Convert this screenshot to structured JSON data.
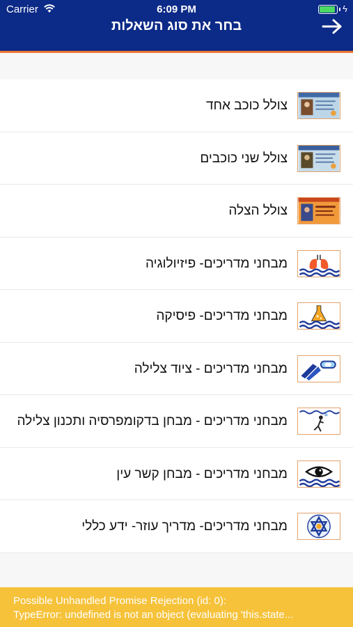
{
  "status_bar": {
    "carrier": "Carrier",
    "time": "6:09 PM",
    "battery_level": 0.9,
    "battery_color": "#4cd964"
  },
  "header": {
    "title": "בחר את סוג השאלות",
    "back_icon": "arrow-right-icon",
    "background": "#0c2a87",
    "accent": "#f0762f"
  },
  "items": [
    {
      "label": "צולל כוכב אחד",
      "icon": "one-star-card-icon"
    },
    {
      "label": "צולל שני כוכבים",
      "icon": "two-star-card-icon"
    },
    {
      "label": "צולל הצלה",
      "icon": "rescue-card-icon"
    },
    {
      "label": "מבחני מדריכים- פיזיולוגיה",
      "icon": "lungs-waves-icon"
    },
    {
      "label": "מבחני מדריכים- פיסיקה",
      "icon": "flask-waves-icon"
    },
    {
      "label": "מבחני מדריכים - ציוד צלילה",
      "icon": "fins-mask-icon"
    },
    {
      "label": "מבחני מדריכים - מבחן בדקומפרסיה ותכנון צלילה",
      "icon": "diver-waves-icon"
    },
    {
      "label": "מבחני מדריכים - מבחן קשר עין",
      "icon": "eye-waves-icon"
    },
    {
      "label": "מבחני מדריכים- מדריך עוזר- ידע כללי",
      "icon": "star-emblem-icon"
    }
  ],
  "warning": {
    "line1": "Possible Unhandled Promise Rejection (id: 0):",
    "line2": "TypeError: undefined is not an object (evaluating 'this.state...",
    "background": "#f6c23a"
  }
}
